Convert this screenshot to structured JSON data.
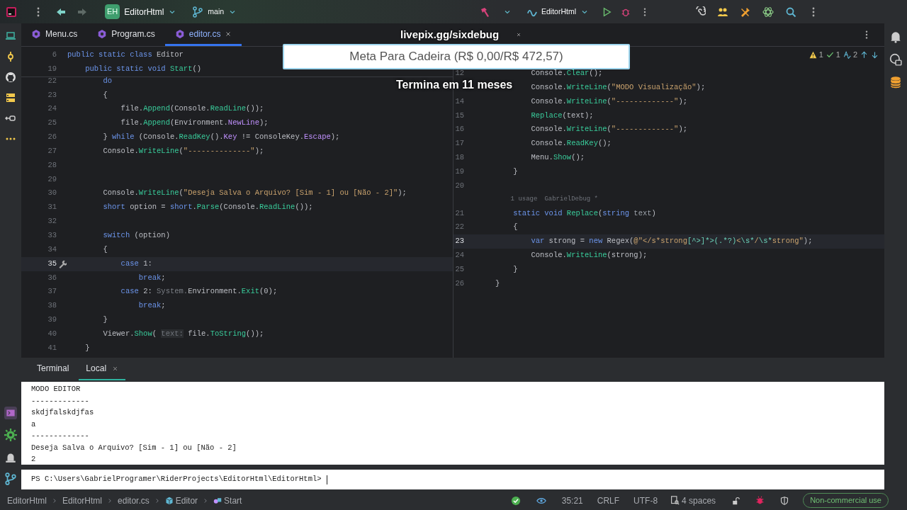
{
  "title_bar": {
    "project_badge": "EH",
    "project": "EditorHtml",
    "branch": "main",
    "run_config": "EditorHtml"
  },
  "editor_tabs": [
    {
      "label": "Menu.cs",
      "selected": false,
      "closable": false
    },
    {
      "label": "Program.cs",
      "selected": false,
      "closable": false
    },
    {
      "label": "editor.cs",
      "selected": true,
      "closable": true
    }
  ],
  "overlay": {
    "link": "livepix.gg/sixdebug",
    "goal": "Meta Para Cadeira (R$ 0,00/R$ 472,57)",
    "ends": "Termina em 11 meses"
  },
  "left_pane": {
    "sticky": [
      {
        "kind": "code",
        "n": "6",
        "current": false,
        "tokens": [
          {
            "text": "public static class ",
            "kind": "keyword"
          },
          {
            "text": "Editor",
            "kind": "plain"
          }
        ]
      },
      {
        "kind": "code",
        "n": "19",
        "current": false,
        "tokens": [
          {
            "text": "    public static void ",
            "kind": "keyword"
          },
          {
            "text": "Start",
            "kind": "method"
          },
          {
            "text": "()",
            "kind": "plain"
          }
        ]
      }
    ],
    "lines": [
      {
        "kind": "code",
        "n": "22",
        "current": false,
        "tokens": [
          {
            "text": "        do",
            "kind": "keyword"
          }
        ]
      },
      {
        "kind": "code",
        "n": "23",
        "current": false,
        "tokens": [
          {
            "text": "        {",
            "kind": "plain"
          }
        ]
      },
      {
        "kind": "code",
        "n": "24",
        "current": false,
        "tokens": [
          {
            "text": "            file.",
            "kind": "plain"
          },
          {
            "text": "Append",
            "kind": "method"
          },
          {
            "text": "(Console.",
            "kind": "plain"
          },
          {
            "text": "ReadLine",
            "kind": "method"
          },
          {
            "text": "());",
            "kind": "plain"
          }
        ]
      },
      {
        "kind": "code",
        "n": "25",
        "current": false,
        "tokens": [
          {
            "text": "            file.",
            "kind": "plain"
          },
          {
            "text": "Append",
            "kind": "method"
          },
          {
            "text": "(Environment.",
            "kind": "plain"
          },
          {
            "text": "NewLine",
            "kind": "member"
          },
          {
            "text": ");",
            "kind": "plain"
          }
        ]
      },
      {
        "kind": "code",
        "n": "26",
        "current": false,
        "tokens": [
          {
            "text": "        } ",
            "kind": "plain"
          },
          {
            "text": "while",
            "kind": "keyword"
          },
          {
            "text": " (Console.",
            "kind": "plain"
          },
          {
            "text": "ReadKey",
            "kind": "method"
          },
          {
            "text": "().",
            "kind": "plain"
          },
          {
            "text": "Key",
            "kind": "member"
          },
          {
            "text": " != ConsoleKey.",
            "kind": "plain"
          },
          {
            "text": "Escape",
            "kind": "member"
          },
          {
            "text": ");",
            "kind": "plain"
          }
        ]
      },
      {
        "kind": "code",
        "n": "27",
        "current": false,
        "tokens": [
          {
            "text": "        Console.",
            "kind": "plain"
          },
          {
            "text": "WriteLine",
            "kind": "method"
          },
          {
            "text": "(",
            "kind": "plain"
          },
          {
            "text": "\"--------------\"",
            "kind": "string"
          },
          {
            "text": ");",
            "kind": "plain"
          }
        ]
      },
      {
        "kind": "code",
        "n": "28",
        "current": false
      },
      {
        "kind": "code",
        "n": "29",
        "current": false
      },
      {
        "kind": "code",
        "n": "30",
        "current": false,
        "tokens": [
          {
            "text": "        Console.",
            "kind": "plain"
          },
          {
            "text": "WriteLine",
            "kind": "method"
          },
          {
            "text": "(",
            "kind": "plain"
          },
          {
            "text": "\"Deseja Salva o Arquivo? [Sim - 1] ou [Não - 2]\"",
            "kind": "string"
          },
          {
            "text": ");",
            "kind": "plain"
          }
        ]
      },
      {
        "kind": "code",
        "n": "31",
        "current": false,
        "tokens": [
          {
            "text": "        short",
            "kind": "keyword"
          },
          {
            "text": " option = ",
            "kind": "plain"
          },
          {
            "text": "short",
            "kind": "keyword"
          },
          {
            "text": ".",
            "kind": "plain"
          },
          {
            "text": "Parse",
            "kind": "method"
          },
          {
            "text": "(Console.",
            "kind": "plain"
          },
          {
            "text": "ReadLine",
            "kind": "method"
          },
          {
            "text": "());",
            "kind": "plain"
          }
        ]
      },
      {
        "kind": "code",
        "n": "32",
        "current": false
      },
      {
        "kind": "code",
        "n": "33",
        "current": false,
        "tokens": [
          {
            "text": "        switch",
            "kind": "keyword"
          },
          {
            "text": " (option)",
            "kind": "plain"
          }
        ]
      },
      {
        "kind": "code",
        "n": "34",
        "current": false,
        "tokens": [
          {
            "text": "        {",
            "kind": "plain"
          }
        ]
      },
      {
        "kind": "code",
        "n": "35",
        "current": true,
        "intention": true,
        "tokens": [
          {
            "text": "            case",
            "kind": "keyword"
          },
          {
            "text": " 1:",
            "kind": "plain"
          }
        ]
      },
      {
        "kind": "code",
        "n": "36",
        "current": false,
        "tokens": [
          {
            "text": "                break",
            "kind": "keyword"
          },
          {
            "text": ";",
            "kind": "plain"
          }
        ]
      },
      {
        "kind": "code",
        "n": "37",
        "current": false,
        "tokens": [
          {
            "text": "            case",
            "kind": "keyword"
          },
          {
            "text": " 2: ",
            "kind": "plain"
          },
          {
            "text": "System.",
            "kind": "dim"
          },
          {
            "text": "Environment.",
            "kind": "plain"
          },
          {
            "text": "Exit",
            "kind": "method"
          },
          {
            "text": "(0);",
            "kind": "plain"
          }
        ]
      },
      {
        "kind": "code",
        "n": "38",
        "current": false,
        "tokens": [
          {
            "text": "                break",
            "kind": "keyword"
          },
          {
            "text": ";",
            "kind": "plain"
          }
        ]
      },
      {
        "kind": "code",
        "n": "39",
        "current": false,
        "tokens": [
          {
            "text": "        }",
            "kind": "plain"
          }
        ]
      },
      {
        "kind": "code",
        "n": "40",
        "current": false,
        "tokens": [
          {
            "text": "        Viewer.",
            "kind": "plain"
          },
          {
            "text": "Show",
            "kind": "method"
          },
          {
            "text": "( ",
            "kind": "plain"
          },
          {
            "text": "text:",
            "kind": "inlay"
          },
          {
            "text": " file.",
            "kind": "plain"
          },
          {
            "text": "ToString",
            "kind": "method"
          },
          {
            "text": "());",
            "kind": "plain"
          }
        ]
      },
      {
        "kind": "code",
        "n": "41",
        "current": false,
        "tokens": [
          {
            "text": "    }",
            "kind": "plain"
          }
        ]
      }
    ]
  },
  "right_pane": {
    "inspections": {
      "warnings": "1",
      "checks": "1",
      "typos": "2"
    },
    "lines": [
      {
        "kind": "code",
        "n": "12",
        "current": false,
        "tokens": [
          {
            "text": "        Console.",
            "kind": "plain"
          },
          {
            "text": "Clear",
            "kind": "method"
          },
          {
            "text": "();",
            "kind": "plain"
          }
        ]
      },
      {
        "kind": "code",
        "current": false,
        "tokens": [
          {
            "text": "        Console.",
            "kind": "plain"
          },
          {
            "text": "WriteLine",
            "kind": "method"
          },
          {
            "text": "(",
            "kind": "plain"
          },
          {
            "text": "\"MODO Visualização\"",
            "kind": "string"
          },
          {
            "text": ");",
            "kind": "plain"
          }
        ]
      },
      {
        "kind": "code",
        "n": "14",
        "current": false,
        "tokens": [
          {
            "text": "        Console.",
            "kind": "plain"
          },
          {
            "text": "WriteLine",
            "kind": "method"
          },
          {
            "text": "(",
            "kind": "plain"
          },
          {
            "text": "\"-------------\"",
            "kind": "string"
          },
          {
            "text": ");",
            "kind": "plain"
          }
        ]
      },
      {
        "kind": "code",
        "n": "15",
        "current": false,
        "tokens": [
          {
            "text": "        Replace",
            "kind": "method"
          },
          {
            "text": "(text);",
            "kind": "plain"
          }
        ]
      },
      {
        "kind": "code",
        "n": "16",
        "current": false,
        "tokens": [
          {
            "text": "        Console.",
            "kind": "plain"
          },
          {
            "text": "WriteLine",
            "kind": "method"
          },
          {
            "text": "(",
            "kind": "plain"
          },
          {
            "text": "\"-------------\"",
            "kind": "string"
          },
          {
            "text": ");",
            "kind": "plain"
          }
        ]
      },
      {
        "kind": "code",
        "n": "17",
        "current": false,
        "tokens": [
          {
            "text": "        Console.",
            "kind": "plain"
          },
          {
            "text": "ReadKey",
            "kind": "method"
          },
          {
            "text": "();",
            "kind": "plain"
          }
        ]
      },
      {
        "kind": "code",
        "n": "18",
        "current": false,
        "tokens": [
          {
            "text": "        Menu.",
            "kind": "plain"
          },
          {
            "text": "Show",
            "kind": "method"
          },
          {
            "text": "();",
            "kind": "plain"
          }
        ]
      },
      {
        "kind": "code",
        "n": "19",
        "current": false,
        "tokens": [
          {
            "text": "    }",
            "kind": "plain"
          }
        ]
      },
      {
        "kind": "code",
        "n": "20",
        "current": false
      },
      {
        "kind": "lens",
        "usages": "1 usage",
        "author": "GabrielDebug *"
      },
      {
        "kind": "code",
        "n": "21",
        "current": false,
        "tokens": [
          {
            "text": "    static void ",
            "kind": "keyword"
          },
          {
            "text": "Replace",
            "kind": "method"
          },
          {
            "text": "(",
            "kind": "plain"
          },
          {
            "text": "string",
            "kind": "keyword"
          },
          {
            "text": " text",
            "kind": "param"
          },
          {
            "text": ")",
            "kind": "plain"
          }
        ]
      },
      {
        "kind": "code",
        "n": "22",
        "current": false,
        "tokens": [
          {
            "text": "    {",
            "kind": "plain"
          }
        ]
      },
      {
        "kind": "code",
        "n": "23",
        "current": true,
        "tokens": [
          {
            "text": "        var",
            "kind": "keyword"
          },
          {
            "text": " strong = ",
            "kind": "plain"
          },
          {
            "text": "new",
            "kind": "keyword"
          },
          {
            "text": " Regex(",
            "kind": "plain"
          },
          {
            "text": "@\"</s*strong",
            "kind": "string"
          },
          {
            "text": "[^>]*>",
            "kind": "regex"
          },
          {
            "text": "(.*?)",
            "kind": "regex"
          },
          {
            "text": "<",
            "kind": "string"
          },
          {
            "text": "\\s*",
            "kind": "regex"
          },
          {
            "text": "/",
            "kind": "string"
          },
          {
            "text": "\\s*",
            "kind": "regex"
          },
          {
            "text": "strong\"",
            "kind": "string"
          },
          {
            "text": ");",
            "kind": "plain"
          }
        ]
      },
      {
        "kind": "code",
        "n": "24",
        "current": false,
        "tokens": [
          {
            "text": "        Console.",
            "kind": "plain"
          },
          {
            "text": "WriteLine",
            "kind": "method"
          },
          {
            "text": "(strong);",
            "kind": "plain"
          }
        ]
      },
      {
        "kind": "code",
        "n": "25",
        "current": false,
        "tokens": [
          {
            "text": "    }",
            "kind": "plain"
          }
        ]
      },
      {
        "kind": "code",
        "n": "26",
        "current": false,
        "tokens": [
          {
            "text": "}",
            "kind": "plain"
          }
        ]
      }
    ]
  },
  "terminal": {
    "title": "Terminal",
    "tabs": [
      {
        "label": "Local",
        "selected": true
      }
    ],
    "output": [
      "MODO EDITOR",
      "-------------",
      "skdjfalskdjfas",
      "a",
      "-------------",
      "Deseja Salva o Arquivo? [Sim - 1] ou [Não - 2]",
      "2"
    ],
    "prompt": "PS C:\\Users\\GabrielProgramer\\RiderProjects\\EditorHtml\\EditorHtml>"
  },
  "status_bar": {
    "breadcrumbs": [
      {
        "label": "EditorHtml",
        "kind": "folder"
      },
      {
        "label": "EditorHtml",
        "kind": "folder"
      },
      {
        "label": "editor.cs",
        "kind": "file"
      },
      {
        "label": "Editor",
        "kind": "class"
      },
      {
        "label": "Start",
        "kind": "method"
      }
    ],
    "position": "35:21",
    "line_ending": "CRLF",
    "encoding": "UTF-8",
    "indent": "4 spaces",
    "license": "Non-commercial use"
  }
}
